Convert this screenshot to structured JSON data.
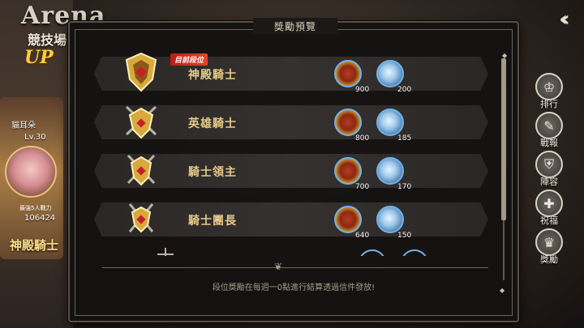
{
  "background": {
    "arena_title": "Arena",
    "arena_subtitle": "競技場",
    "up_badge": "UP",
    "player": {
      "name": "貓耳朵",
      "level": "Lv.30",
      "power_label": "最強5人戰力",
      "power": "106424",
      "rank": "神殿騎士"
    }
  },
  "side_menu": [
    {
      "label": "排行",
      "icon": "rank-icon"
    },
    {
      "label": "戰報",
      "icon": "battle-report-icon"
    },
    {
      "label": "陣容",
      "icon": "lineup-icon"
    },
    {
      "label": "祝福",
      "icon": "blessing-icon"
    },
    {
      "label": "獎勵",
      "icon": "reward-icon"
    }
  ],
  "panel": {
    "title": "獎勵預覽",
    "current_badge": "目前段位",
    "footer": "段位獎勵在每週一0點進行結算透過信件發放!",
    "tiers": [
      {
        "name": "神殿騎士",
        "gold": "900",
        "crystal": "200",
        "current": true
      },
      {
        "name": "英雄騎士",
        "gold": "800",
        "crystal": "185",
        "current": false
      },
      {
        "name": "騎士領主",
        "gold": "700",
        "crystal": "170",
        "current": false
      },
      {
        "name": "騎士團長",
        "gold": "640",
        "crystal": "150",
        "current": false
      }
    ]
  },
  "colors": {
    "accent_gold": "#e6c98a",
    "badge_red": "#d3321f",
    "ring_blue": "#6fb3e6"
  }
}
